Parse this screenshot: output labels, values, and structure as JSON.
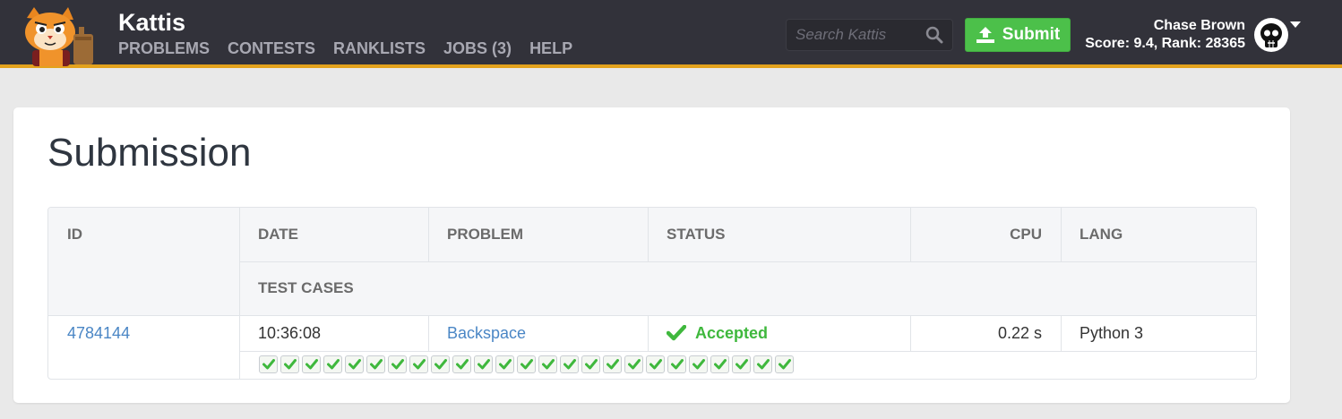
{
  "header": {
    "brand": "Kattis",
    "nav": [
      "PROBLEMS",
      "CONTESTS",
      "RANKLISTS",
      "JOBS (3)",
      "HELP"
    ],
    "search_placeholder": "Search Kattis",
    "submit_label": "Submit",
    "user_name": "Chase Brown",
    "user_stats": "Score: 9.4, Rank: 28365"
  },
  "colors": {
    "header_bg": "#32323a",
    "accent_orange": "#e3a21c",
    "submit_green": "#4cc04a",
    "accepted_green": "#3fb83d",
    "link_blue": "#4a86c5"
  },
  "icons": [
    "kattis-cat-logo",
    "search-icon",
    "upload-icon",
    "skull-avatar-icon",
    "caret-down-icon",
    "checkmark-icon"
  ],
  "page": {
    "title": "Submission"
  },
  "table": {
    "headers": {
      "id": "ID",
      "date": "DATE",
      "problem": "PROBLEM",
      "status": "STATUS",
      "cpu": "CPU",
      "lang": "LANG",
      "test_cases": "TEST CASES"
    },
    "row": {
      "id": "4784144",
      "date": "10:36:08",
      "problem": "Backspace",
      "status": "Accepted",
      "cpu": "0.22 s",
      "lang": "Python 3",
      "test_cases_passed": 25,
      "test_cases_total": 25
    }
  }
}
